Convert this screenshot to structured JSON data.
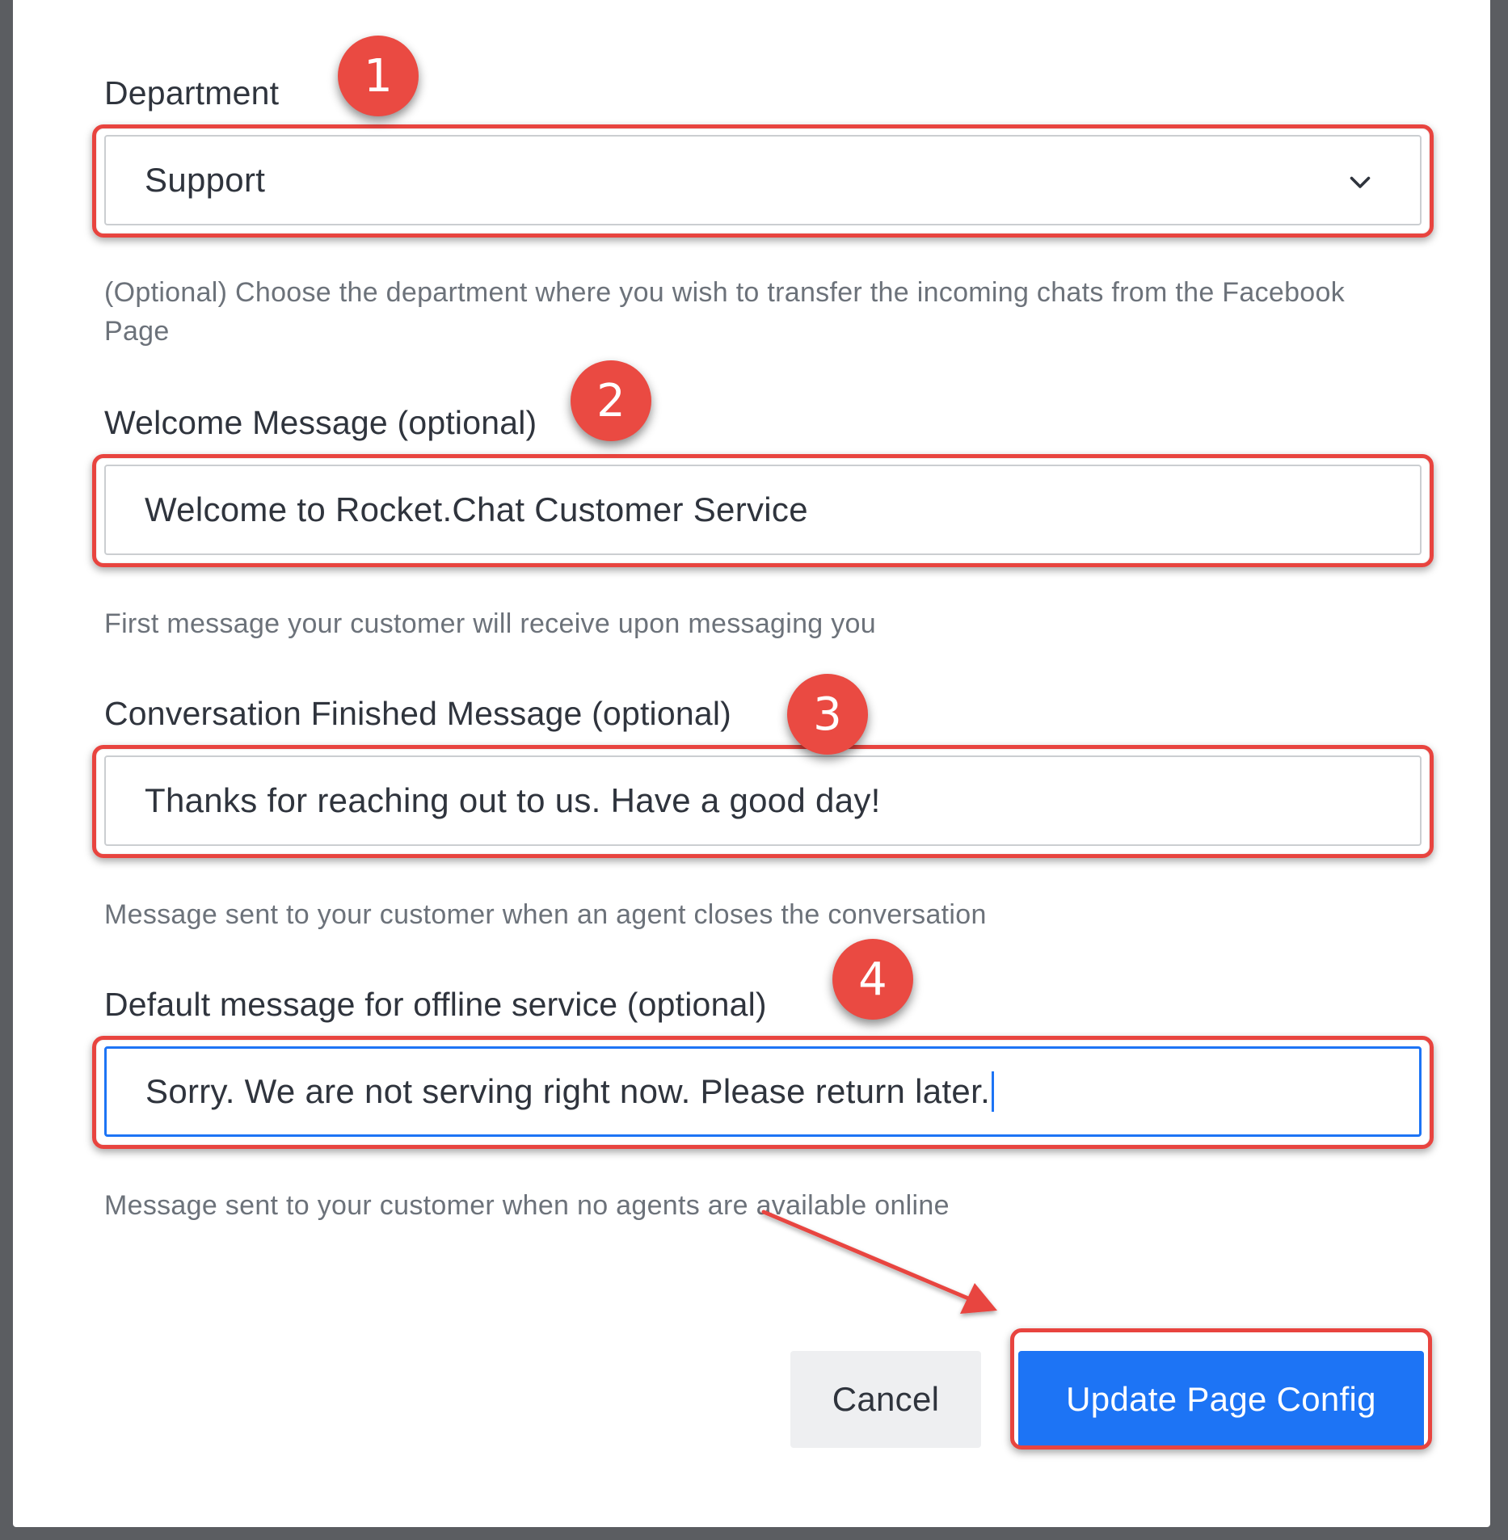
{
  "form": {
    "department": {
      "label": "Department",
      "value": "Support",
      "hint": "(Optional) Choose the department where you wish to transfer the incoming chats from the Facebook Page",
      "badge": "1"
    },
    "welcome": {
      "label": "Welcome Message (optional)",
      "value": "Welcome to Rocket.Chat Customer Service",
      "hint": "First message your customer will receive upon messaging you",
      "badge": "2"
    },
    "finished": {
      "label": "Conversation Finished Message (optional)",
      "value": "Thanks for reaching out to us. Have a good day!",
      "hint": "Message sent to your customer when an agent closes the conversation",
      "badge": "3"
    },
    "offline": {
      "label": "Default message for offline service (optional)",
      "value": "Sorry. We are not serving right now. Please return later.",
      "hint": "Message sent to your customer when no agents are available online",
      "badge": "4"
    }
  },
  "actions": {
    "cancel_label": "Cancel",
    "submit_label": "Update Page Config"
  },
  "colors": {
    "accent": "#1d74f5",
    "annotation": "#e8443f",
    "backdrop": "#5b5d61"
  },
  "icons": {
    "select_chevron": "chevron-down-icon",
    "annotation_arrow": "arrow-icon"
  }
}
